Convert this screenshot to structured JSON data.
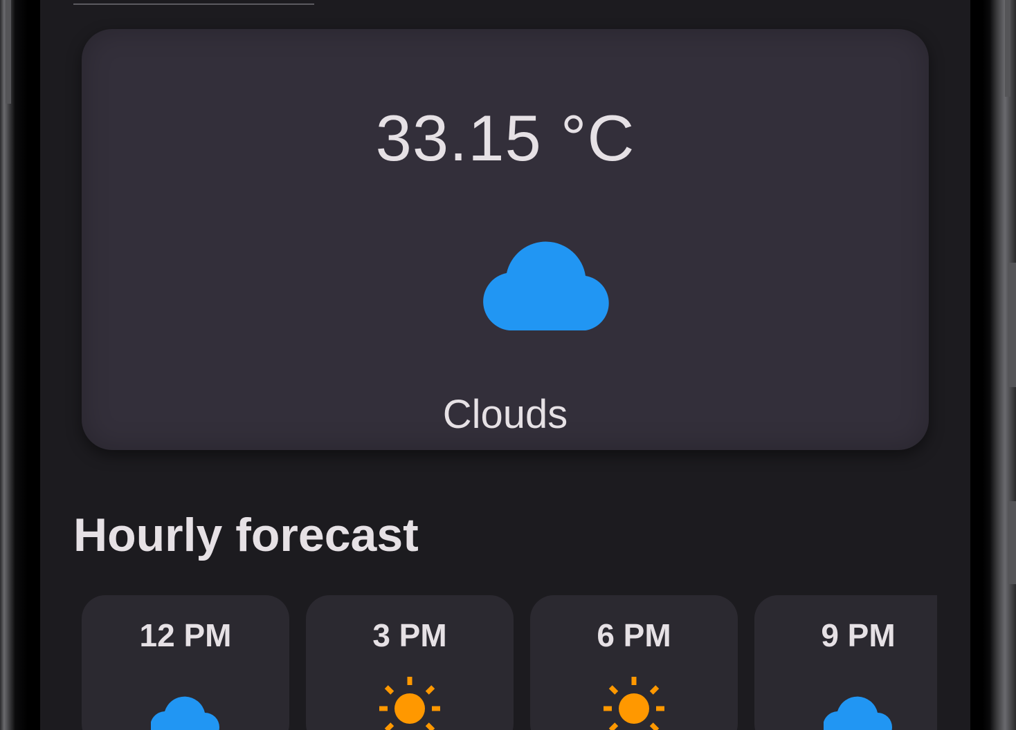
{
  "current": {
    "temperature": "33.15 °C",
    "condition": "Clouds",
    "icon": "cloud-icon"
  },
  "hourly": {
    "title": "Hourly forecast",
    "items": [
      {
        "time": "12 PM",
        "icon": "cloud-icon"
      },
      {
        "time": "3 PM",
        "icon": "sun-icon"
      },
      {
        "time": "6 PM",
        "icon": "sun-icon"
      },
      {
        "time": "9 PM",
        "icon": "cloud-icon"
      }
    ]
  },
  "colors": {
    "cloud": "#2196f3",
    "sun": "#ff9800",
    "background": "#1c1b1f",
    "card": "#332f3a",
    "text": "#e6e1e5"
  }
}
